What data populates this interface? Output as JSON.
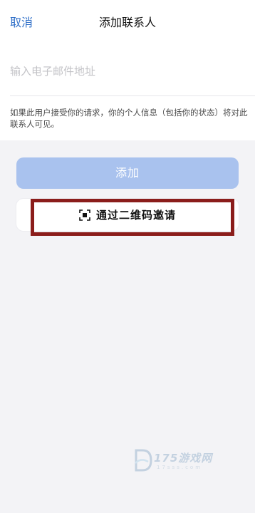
{
  "header": {
    "cancel_label": "取消",
    "title": "添加联系人"
  },
  "form": {
    "email_placeholder": "输入电子邮件地址",
    "email_value": "",
    "info_text": "如果此用户接受你的请求，你的个人信息（包括你的状态）将对此联系人可见。"
  },
  "actions": {
    "add_label": "添加",
    "qr_invite_label": "通过二维码邀请",
    "qr_icon": "qr-scan-icon"
  },
  "watermark": {
    "text": "175游戏网",
    "sub": "17sss.com"
  },
  "colors": {
    "accent": "#2f6fc8",
    "add_button_disabled": "#a9c2ee",
    "highlight_border": "#8b1d1b",
    "background": "#f3f3f6"
  }
}
